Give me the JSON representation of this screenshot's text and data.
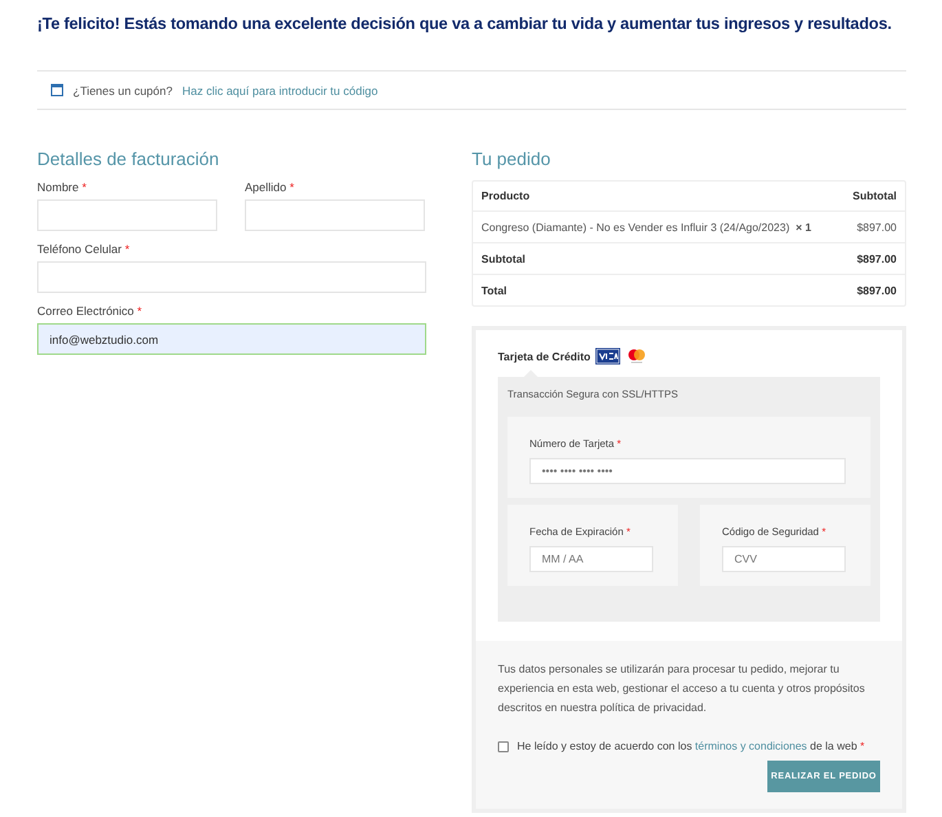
{
  "headline": "¡Te felicito! Estás tomando una excelente decisión que va a cambiar tu vida y aumentar tus ingresos y resultados.",
  "coupon": {
    "question": "¿Tienes un cupón?",
    "link": "Haz clic aquí para introducir tu código"
  },
  "billing": {
    "title": "Detalles de facturación",
    "fields": [
      {
        "label": "Nombre",
        "required_mark": "*",
        "kind": "half",
        "highlighted": false
      },
      {
        "label": "Apellido",
        "required_mark": "*",
        "kind": "half",
        "highlighted": false
      },
      {
        "label": "Teléfono Celular",
        "required_mark": "*",
        "kind": "full",
        "highlighted": false
      },
      {
        "label": "Correo Electrónico",
        "required_mark": "*",
        "value": "info@webztudio.com",
        "kind": "full",
        "highlighted": true
      }
    ]
  },
  "order": {
    "title": "Tu pedido",
    "columns": [
      "Producto",
      "Subtotal"
    ],
    "rows": [
      {
        "kind": "item",
        "label": "Congreso (Diamante) - No es Vender es Influir 3 (24/Ago/2023)",
        "quantity": "× 1",
        "amount": "$897.00"
      },
      {
        "kind": "total",
        "label": "Subtotal",
        "amount": "$897.00"
      },
      {
        "kind": "total",
        "label": "Total",
        "amount": "$897.00"
      }
    ]
  },
  "payment": {
    "method": "Tarjeta de Crédito",
    "security_note": "Transacción Segura con SSL/HTTPS",
    "card_number": {
      "label": "Número de Tarjeta",
      "required_mark": "*",
      "placeholder": "•••• •••• •••• ••••"
    },
    "expiry": {
      "label": "Fecha de Expiración",
      "required_mark": "*",
      "placeholder": "MM / AA"
    },
    "cvv": {
      "label": "Código de Seguridad",
      "required_mark": "*",
      "placeholder": "CVV"
    }
  },
  "privacy": "Tus datos personales se utilizarán para procesar tu pedido, mejorar tu experiencia en esta web, gestionar el acceso a tu cuenta y otros propósitos descritos en nuestra política de privacidad.",
  "terms": {
    "checked": false,
    "before": "He leído y estoy de acuerdo con los",
    "link": "términos y condiciones",
    "after": "de la web",
    "required_mark": "*"
  },
  "submit": "REALIZAR EL PEDIDO"
}
